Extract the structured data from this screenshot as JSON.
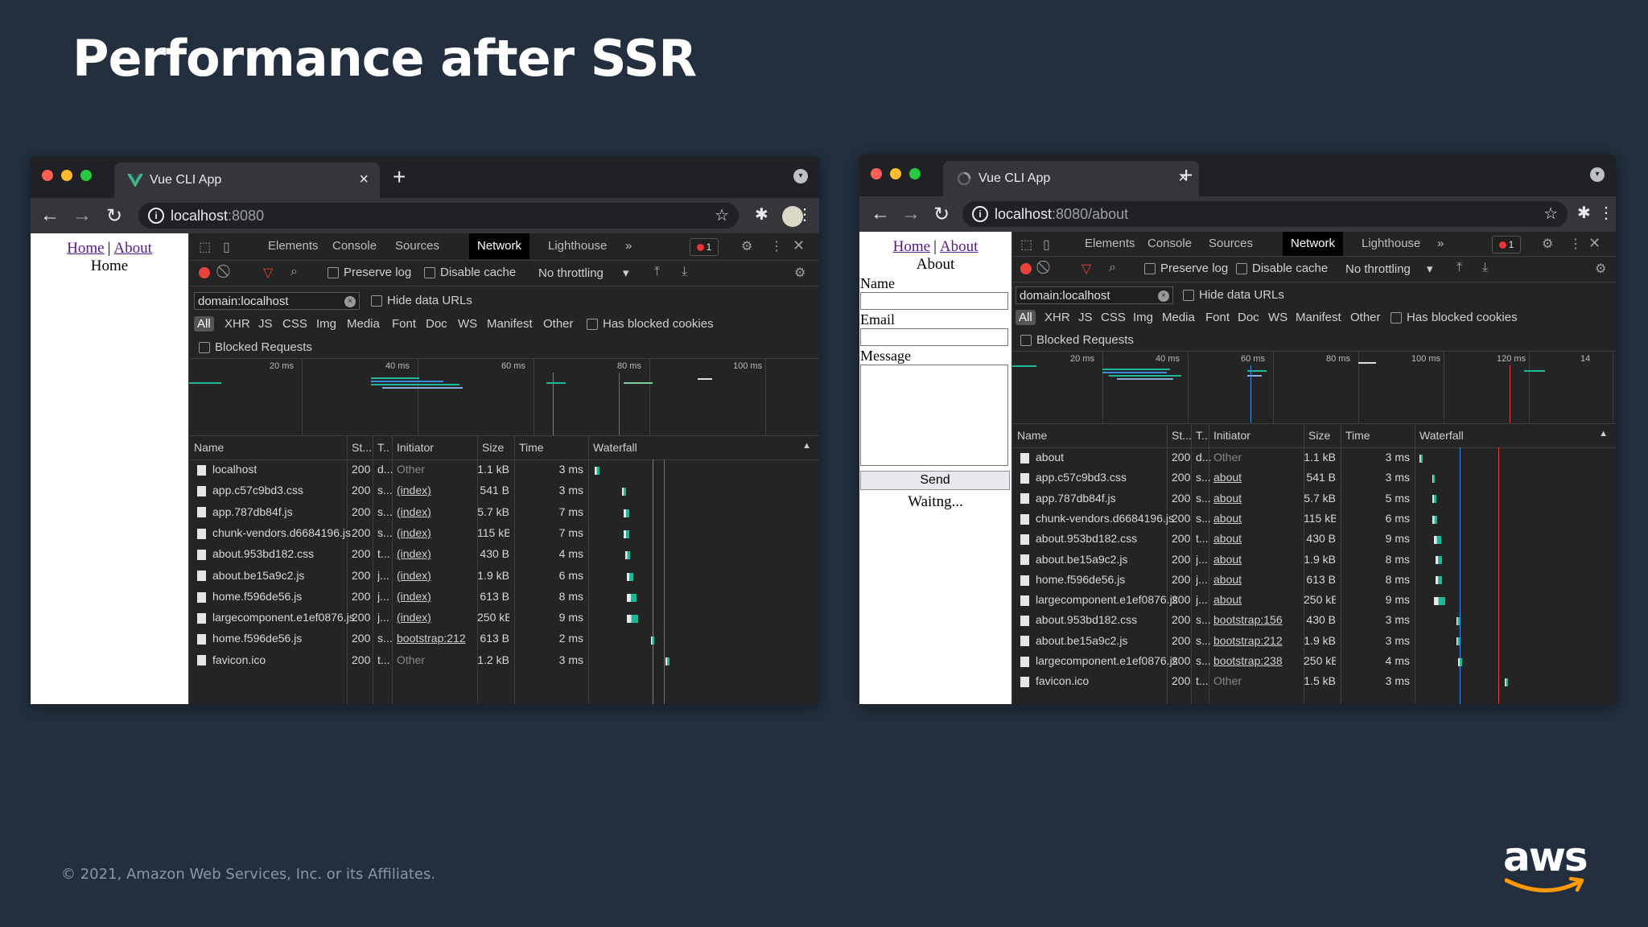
{
  "slide": {
    "title": "Performance after SSR",
    "footer": "© 2021, Amazon Web Services, Inc. or its Affiliates.",
    "logo_text": "aws"
  },
  "colors": {
    "background": "#232f3e",
    "close_dot": "#ff5f57",
    "min_dot": "#febc2e",
    "max_dot": "#28c840",
    "aws_orange": "#ff9900",
    "waterfall_green": "#1fb897",
    "waterfall_blue": "#3d8fe6",
    "load_red": "#e33a3a"
  },
  "left_browser": {
    "tab_title": "Vue CLI App",
    "url_host": "localhost",
    "url_rest": ":8080",
    "page": {
      "nav_home": "Home",
      "nav_sep": "|",
      "nav_about": "About",
      "heading": "Home"
    },
    "devtools": {
      "tabs": [
        "Elements",
        "Console",
        "Sources",
        "Network",
        "Lighthouse",
        "»"
      ],
      "active_tab": "Network",
      "error_count": "1",
      "preserve_log": "Preserve log",
      "disable_cache": "Disable cache",
      "throttling": "No throttling",
      "filter_value": "domain:localhost",
      "hide_data_urls": "Hide data URLs",
      "types": [
        "All",
        "XHR",
        "JS",
        "CSS",
        "Img",
        "Media",
        "Font",
        "Doc",
        "WS",
        "Manifest",
        "Other"
      ],
      "has_blocked_cookies": "Has blocked cookies",
      "blocked_requests": "Blocked Requests",
      "overview_ticks": [
        "20 ms",
        "40 ms",
        "60 ms",
        "80 ms",
        "100 ms"
      ],
      "headers": [
        "Name",
        "St...",
        "T..",
        "Initiator",
        "Size",
        "Time",
        "Waterfall"
      ],
      "rows": [
        {
          "name": "localhost",
          "status": "200",
          "type": "d...",
          "initiator": "Other",
          "initiator_link": false,
          "size": "1.1 kB",
          "time": "3 ms"
        },
        {
          "name": "app.c57c9bd3.css",
          "status": "200",
          "type": "s...",
          "initiator": "(index)",
          "initiator_link": true,
          "size": "541 B",
          "time": "3 ms"
        },
        {
          "name": "app.787db84f.js",
          "status": "200",
          "type": "s...",
          "initiator": "(index)",
          "initiator_link": true,
          "size": "5.7 kB",
          "time": "7 ms"
        },
        {
          "name": "chunk-vendors.d6684196.js",
          "status": "200",
          "type": "s...",
          "initiator": "(index)",
          "initiator_link": true,
          "size": "115 kB",
          "time": "7 ms"
        },
        {
          "name": "about.953bd182.css",
          "status": "200",
          "type": "t...",
          "initiator": "(index)",
          "initiator_link": true,
          "size": "430 B",
          "time": "4 ms"
        },
        {
          "name": "about.be15a9c2.js",
          "status": "200",
          "type": "j...",
          "initiator": "(index)",
          "initiator_link": true,
          "size": "1.9 kB",
          "time": "6 ms"
        },
        {
          "name": "home.f596de56.js",
          "status": "200",
          "type": "j...",
          "initiator": "(index)",
          "initiator_link": true,
          "size": "613 B",
          "time": "8 ms"
        },
        {
          "name": "largecomponent.e1ef0876.js",
          "status": "200",
          "type": "j...",
          "initiator": "(index)",
          "initiator_link": true,
          "size": "250 kB",
          "time": "9 ms"
        },
        {
          "name": "home.f596de56.js",
          "status": "200",
          "type": "s...",
          "initiator": "bootstrap:212",
          "initiator_link": true,
          "size": "613 B",
          "time": "2 ms"
        },
        {
          "name": "favicon.ico",
          "status": "200",
          "type": "t...",
          "initiator": "Other",
          "initiator_link": false,
          "size": "1.2 kB",
          "time": "3 ms"
        }
      ]
    }
  },
  "right_browser": {
    "tab_title": "Vue CLI App",
    "url_host": "localhost",
    "url_rest": ":8080/about",
    "page": {
      "nav_home": "Home",
      "nav_sep": "|",
      "nav_about": "About",
      "heading": "About",
      "name_label": "Name",
      "email_label": "Email",
      "message_label": "Message",
      "send_label": "Send",
      "status_text": "Waitng..."
    },
    "devtools": {
      "tabs": [
        "Elements",
        "Console",
        "Sources",
        "Network",
        "Lighthouse",
        "»"
      ],
      "active_tab": "Network",
      "error_count": "1",
      "preserve_log": "Preserve log",
      "disable_cache": "Disable cache",
      "throttling": "No throttling",
      "filter_value": "domain:localhost",
      "hide_data_urls": "Hide data URLs",
      "types": [
        "All",
        "XHR",
        "JS",
        "CSS",
        "Img",
        "Media",
        "Font",
        "Doc",
        "WS",
        "Manifest",
        "Other"
      ],
      "has_blocked_cookies": "Has blocked cookies",
      "blocked_requests": "Blocked Requests",
      "overview_ticks": [
        "20 ms",
        "40 ms",
        "60 ms",
        "80 ms",
        "100 ms",
        "120 ms",
        "14"
      ],
      "headers": [
        "Name",
        "St...",
        "T..",
        "Initiator",
        "Size",
        "Time",
        "Waterfall"
      ],
      "rows": [
        {
          "name": "about",
          "status": "200",
          "type": "d...",
          "initiator": "Other",
          "initiator_link": false,
          "size": "1.1 kB",
          "time": "3 ms"
        },
        {
          "name": "app.c57c9bd3.css",
          "status": "200",
          "type": "s...",
          "initiator": "about",
          "initiator_link": true,
          "size": "541 B",
          "time": "3 ms"
        },
        {
          "name": "app.787db84f.js",
          "status": "200",
          "type": "s...",
          "initiator": "about",
          "initiator_link": true,
          "size": "5.7 kB",
          "time": "5 ms"
        },
        {
          "name": "chunk-vendors.d6684196.js",
          "status": "200",
          "type": "s...",
          "initiator": "about",
          "initiator_link": true,
          "size": "115 kB",
          "time": "6 ms"
        },
        {
          "name": "about.953bd182.css",
          "status": "200",
          "type": "t...",
          "initiator": "about",
          "initiator_link": true,
          "size": "430 B",
          "time": "9 ms"
        },
        {
          "name": "about.be15a9c2.js",
          "status": "200",
          "type": "j...",
          "initiator": "about",
          "initiator_link": true,
          "size": "1.9 kB",
          "time": "8 ms"
        },
        {
          "name": "home.f596de56.js",
          "status": "200",
          "type": "j...",
          "initiator": "about",
          "initiator_link": true,
          "size": "613 B",
          "time": "8 ms"
        },
        {
          "name": "largecomponent.e1ef0876.js",
          "status": "200",
          "type": "j...",
          "initiator": "about",
          "initiator_link": true,
          "size": "250 kB",
          "time": "9 ms"
        },
        {
          "name": "about.953bd182.css",
          "status": "200",
          "type": "s...",
          "initiator": "bootstrap:156",
          "initiator_link": true,
          "size": "430 B",
          "time": "3 ms"
        },
        {
          "name": "about.be15a9c2.js",
          "status": "200",
          "type": "s...",
          "initiator": "bootstrap:212",
          "initiator_link": true,
          "size": "1.9 kB",
          "time": "3 ms"
        },
        {
          "name": "largecomponent.e1ef0876.js",
          "status": "200",
          "type": "s...",
          "initiator": "bootstrap:238",
          "initiator_link": true,
          "size": "250 kB",
          "time": "4 ms"
        },
        {
          "name": "favicon.ico",
          "status": "200",
          "type": "t...",
          "initiator": "Other",
          "initiator_link": false,
          "size": "1.5 kB",
          "time": "3 ms"
        }
      ]
    }
  }
}
